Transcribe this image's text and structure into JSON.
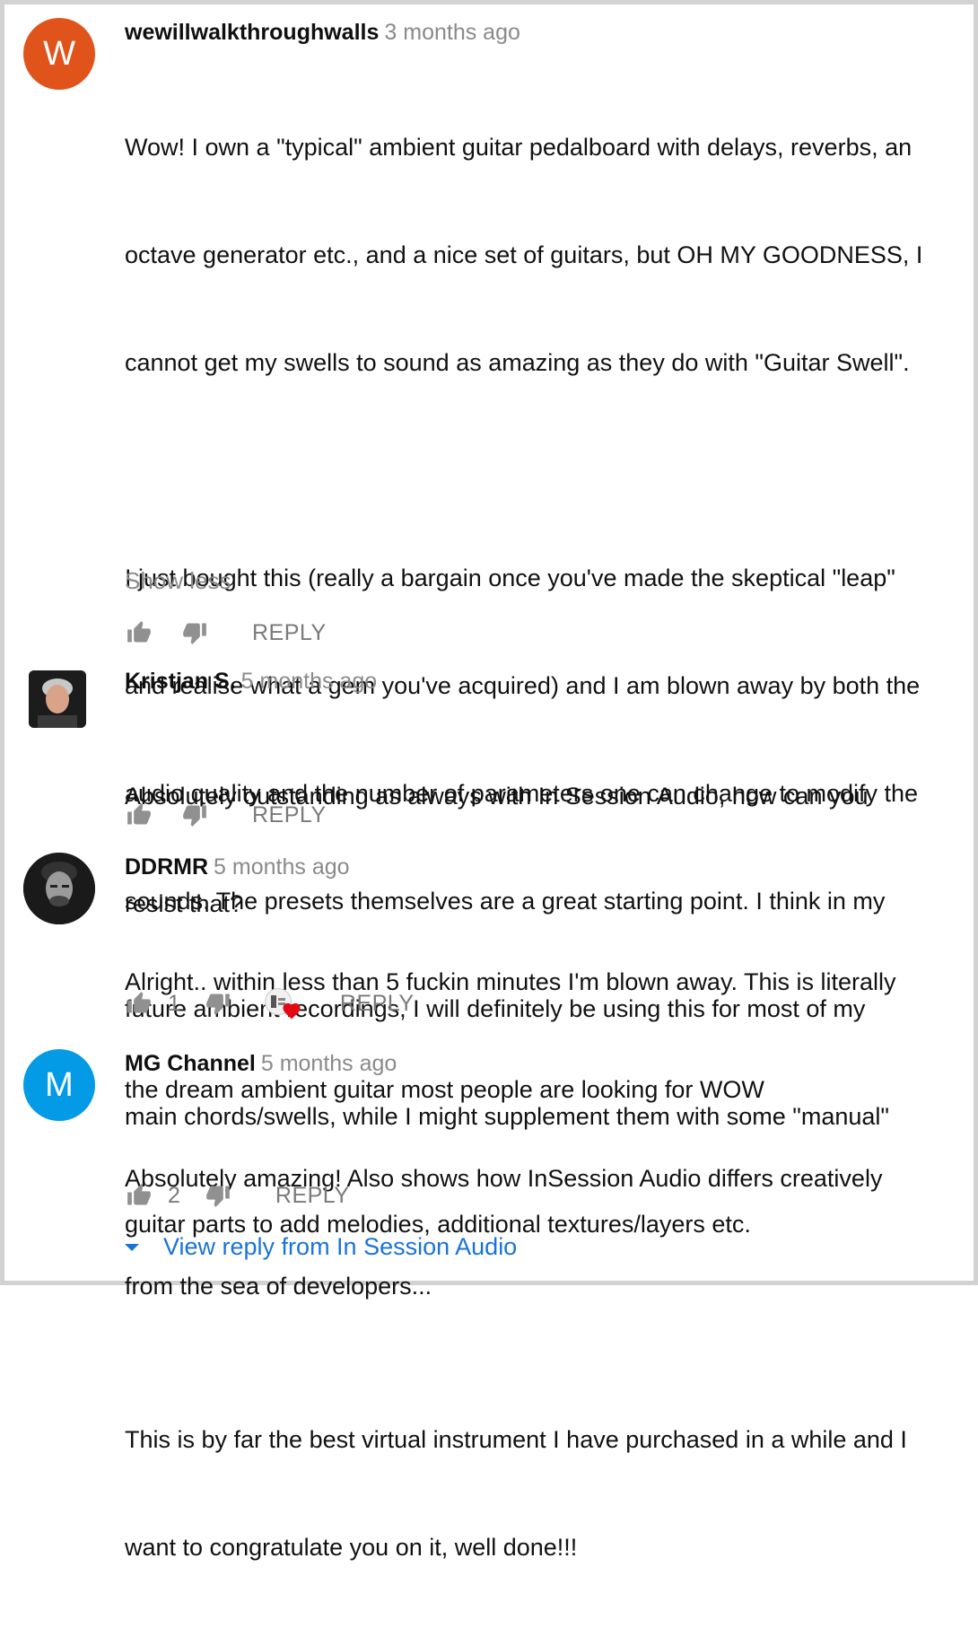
{
  "comments": [
    {
      "avatar_letter": "W",
      "avatar_color": "#e0541c",
      "author": "wewillwalkthroughwalls",
      "time": "3 months ago",
      "text_lines": [
        "Wow! I own a \"typical\" ambient guitar pedalboard with delays, reverbs, an",
        "octave generator etc., and a nice set of guitars, but OH MY GOODNESS, I",
        "cannot get my swells to sound as amazing as they do with \"Guitar Swell\".",
        "",
        "I just bought this (really a bargain once you've made the skeptical \"leap\"",
        "and realise what a gem you've acquired) and I am blown away by both the",
        "audio quality and the number of parameters one can change to modify the",
        "sounds. The presets themselves are a great starting point. I think in my",
        "future ambient recordings, I will definitely be using this for most of my",
        "main chords/swells, while I might supplement them with some \"manual\"",
        "guitar parts to add melodies, additional textures/layers etc.",
        "",
        "This is by far the best virtual instrument I have purchased in a while and I",
        "want to congratulate you on it, well done!!!"
      ],
      "show_less": "Show less",
      "reply": "REPLY"
    },
    {
      "avatar_icon": "user-photo-icon",
      "author": "Kristjan S.",
      "time": "5 months ago",
      "text_lines": [
        "Absolutely outstanding as always with In Session Audio, how can you",
        "resist that?"
      ],
      "reply": "REPLY"
    },
    {
      "avatar_icon": "user-photo-icon",
      "author": "DDRMR",
      "time": "5 months ago",
      "text_lines": [
        "Alright.. within less than 5 fuckin minutes I'm blown away. This is literally",
        "the dream ambient guitar most people are looking for WOW"
      ],
      "likes": "1",
      "hearted_icon": "creator-heart-icon",
      "reply": "REPLY"
    },
    {
      "avatar_letter": "M",
      "avatar_color": "#039be5",
      "author": "MG Channel",
      "time": "5 months ago",
      "text_lines": [
        "Absolutely amazing! Also shows how InSession Audio differs creatively",
        "from the sea of developers..."
      ],
      "likes": "2",
      "reply": "REPLY"
    }
  ],
  "view_reply": "View reply from In Session Audio",
  "colors": {
    "link": "#1a73d9",
    "heart": "#e50914",
    "muted": "#7a7a7a"
  }
}
